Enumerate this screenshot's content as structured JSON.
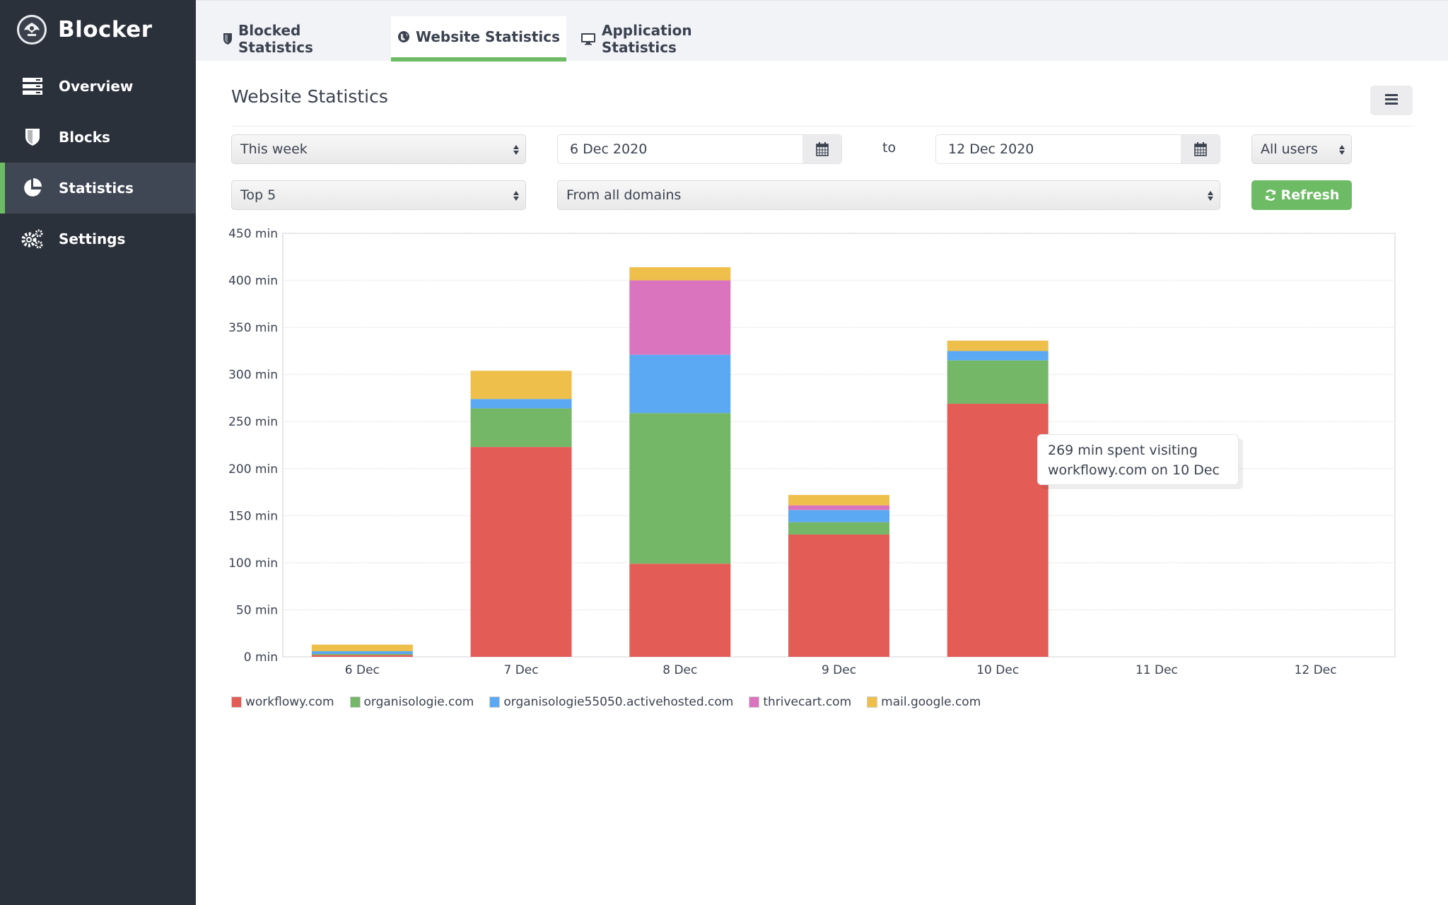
{
  "app": {
    "name": "Blocker",
    "logo_icon": "peacock-logo-icon"
  },
  "sidebar": {
    "items": [
      {
        "label": "Overview",
        "icon": "server-icon",
        "active": false
      },
      {
        "label": "Blocks",
        "icon": "shield-icon",
        "active": false
      },
      {
        "label": "Statistics",
        "icon": "pie-chart-icon",
        "active": true
      },
      {
        "label": "Settings",
        "icon": "gears-icon",
        "active": false
      }
    ]
  },
  "tabs": [
    {
      "label": "Blocked Statistics",
      "icon": "shield-icon",
      "active": false
    },
    {
      "label": "Website Statistics",
      "icon": "globe-icon",
      "active": true
    },
    {
      "label": "Application Statistics",
      "icon": "desktop-icon",
      "active": false
    }
  ],
  "page": {
    "title": "Website Statistics",
    "menu_icon": "hamburger-icon"
  },
  "filters": {
    "period": "This week",
    "from_date": "6 Dec 2020",
    "to_label": "to",
    "to_date": "12 Dec 2020",
    "users": "All users",
    "top": "Top 5",
    "domains": "From all domains",
    "refresh_label": "Refresh",
    "calendar_icon": "calendar-icon",
    "refresh_icon": "refresh-icon"
  },
  "colors": {
    "accent": "#6dbb64",
    "sidebar_bg": "#2b313b",
    "sidebar_active_bg": "#3f4654"
  },
  "tooltip": {
    "line1": "269 min spent visiting",
    "line2": "workflowy.com on 10 Dec"
  },
  "chart_data": {
    "type": "bar",
    "stacked": true,
    "title": "",
    "xlabel": "",
    "ylabel": "",
    "categories": [
      "6 Dec",
      "7 Dec",
      "8 Dec",
      "9 Dec",
      "10 Dec",
      "11 Dec",
      "12 Dec"
    ],
    "ylim": [
      0,
      450
    ],
    "yticks": [
      0,
      50,
      100,
      150,
      200,
      250,
      300,
      350,
      400,
      450
    ],
    "ytick_suffix": " min",
    "grid": true,
    "legend_position": "bottom-left",
    "series": [
      {
        "name": "workflowy.com",
        "color": "#e35d56",
        "values": [
          2,
          223,
          99,
          130,
          269,
          0,
          0
        ]
      },
      {
        "name": "organisologie.com",
        "color": "#74b767",
        "values": [
          1,
          41,
          160,
          13,
          46,
          0,
          0
        ]
      },
      {
        "name": "organisologie55050.activehosted.com",
        "color": "#5ca9f3",
        "values": [
          3,
          10,
          62,
          13,
          10,
          0,
          0
        ]
      },
      {
        "name": "thrivecart.com",
        "color": "#da74be",
        "values": [
          0,
          0,
          79,
          5,
          0,
          0,
          0
        ]
      },
      {
        "name": "mail.google.com",
        "color": "#eebf4b",
        "values": [
          7,
          30,
          14,
          11,
          11,
          0,
          0
        ]
      }
    ]
  }
}
